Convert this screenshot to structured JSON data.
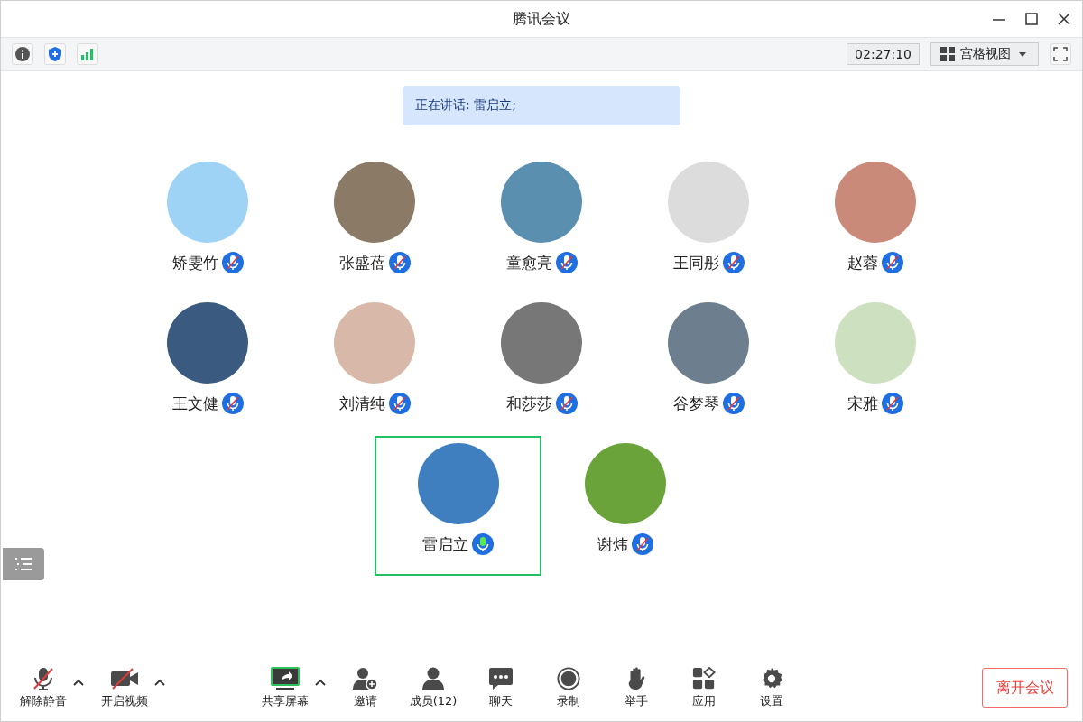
{
  "window": {
    "title": "腾讯会议"
  },
  "topbar": {
    "timer": "02:27:10",
    "view_mode": "宫格视图"
  },
  "speaking": "正在讲话: 雷启立;",
  "participants": [
    {
      "name": "矫雯竹",
      "muted": true,
      "selected": false
    },
    {
      "name": "张盛蓓",
      "muted": true,
      "selected": false
    },
    {
      "name": "童愈亮",
      "muted": true,
      "selected": false
    },
    {
      "name": "王同彤",
      "muted": true,
      "selected": false
    },
    {
      "name": "赵蓉",
      "muted": true,
      "selected": false
    },
    {
      "name": "王文健",
      "muted": true,
      "selected": false
    },
    {
      "name": "刘清纯",
      "muted": true,
      "selected": false
    },
    {
      "name": "和莎莎",
      "muted": true,
      "selected": false
    },
    {
      "name": "谷梦琴",
      "muted": true,
      "selected": false
    },
    {
      "name": "宋雅",
      "muted": true,
      "selected": false
    },
    {
      "name": "雷启立",
      "muted": false,
      "selected": true
    },
    {
      "name": "谢炜",
      "muted": true,
      "selected": false
    }
  ],
  "toolbar": [
    {
      "kind": "mic",
      "label": "解除静音",
      "caret": true
    },
    {
      "kind": "video",
      "label": "开启视频",
      "caret": true
    },
    {
      "kind": "share",
      "label": "共享屏幕",
      "caret": true
    },
    {
      "kind": "invite",
      "label": "邀请",
      "caret": false
    },
    {
      "kind": "members",
      "label": "成员(12)",
      "caret": false
    },
    {
      "kind": "chat",
      "label": "聊天",
      "caret": false
    },
    {
      "kind": "record",
      "label": "录制",
      "caret": false
    },
    {
      "kind": "hand",
      "label": "举手",
      "caret": false
    },
    {
      "kind": "apps",
      "label": "应用",
      "caret": false
    },
    {
      "kind": "settings",
      "label": "设置",
      "caret": false
    }
  ],
  "leave_button": "离开会议"
}
